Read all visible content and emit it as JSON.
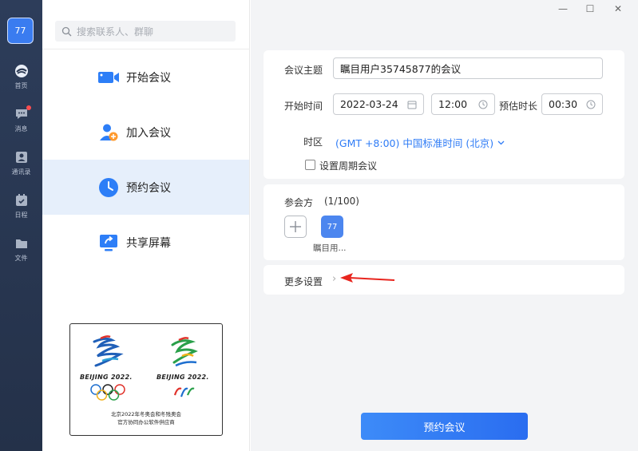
{
  "user": {
    "avatar_text": "77"
  },
  "rail": {
    "items": [
      {
        "label": "首页",
        "icon": "home-icon"
      },
      {
        "label": "消息",
        "icon": "chat-icon"
      },
      {
        "label": "通讯录",
        "icon": "contacts-icon"
      },
      {
        "label": "日程",
        "icon": "calendar-icon"
      },
      {
        "label": "文件",
        "icon": "folder-icon"
      }
    ]
  },
  "search": {
    "placeholder": "搜索联系人、群聊"
  },
  "menu": {
    "items": [
      {
        "label": "开始会议",
        "icon": "video-camera-icon"
      },
      {
        "label": "加入会议",
        "icon": "add-user-icon"
      },
      {
        "label": "预约会议",
        "icon": "clock-icon"
      },
      {
        "label": "共享屏幕",
        "icon": "share-screen-icon"
      }
    ],
    "active_index": 2
  },
  "promo": {
    "text_left": "BEIJING 2022.",
    "text_right": "BEIJING 2022.",
    "caption_line1": "北京2022年冬奥会和冬残奥会",
    "caption_line2": "官方协同办公软件供应商"
  },
  "form": {
    "topic_label": "会议主题",
    "topic_value": "瞩目用户35745877的会议",
    "start_label": "开始时间",
    "start_date": "2022-03-24",
    "start_time": "12:00",
    "duration_label": "预估时长",
    "duration_value": "00:30",
    "timezone_label": "时区",
    "timezone_value": "(GMT +8:00) 中国标准时间 (北京)",
    "recurring_label": "设置周期会议"
  },
  "participants": {
    "title": "参会方",
    "count": "(1/100)",
    "avatar_text": "77",
    "name": "瞩目用..."
  },
  "more_settings": {
    "label": "更多设置",
    "chevron": "›"
  },
  "actions": {
    "schedule_button": "预约会议"
  },
  "window": {
    "minimize": "—",
    "maximize": "☐",
    "close": "✕"
  },
  "colors": {
    "accent": "#2f7cf6",
    "rail_bg": "#2a3852",
    "active_bg": "#e6effb",
    "annotation_arrow": "#e8251e"
  }
}
